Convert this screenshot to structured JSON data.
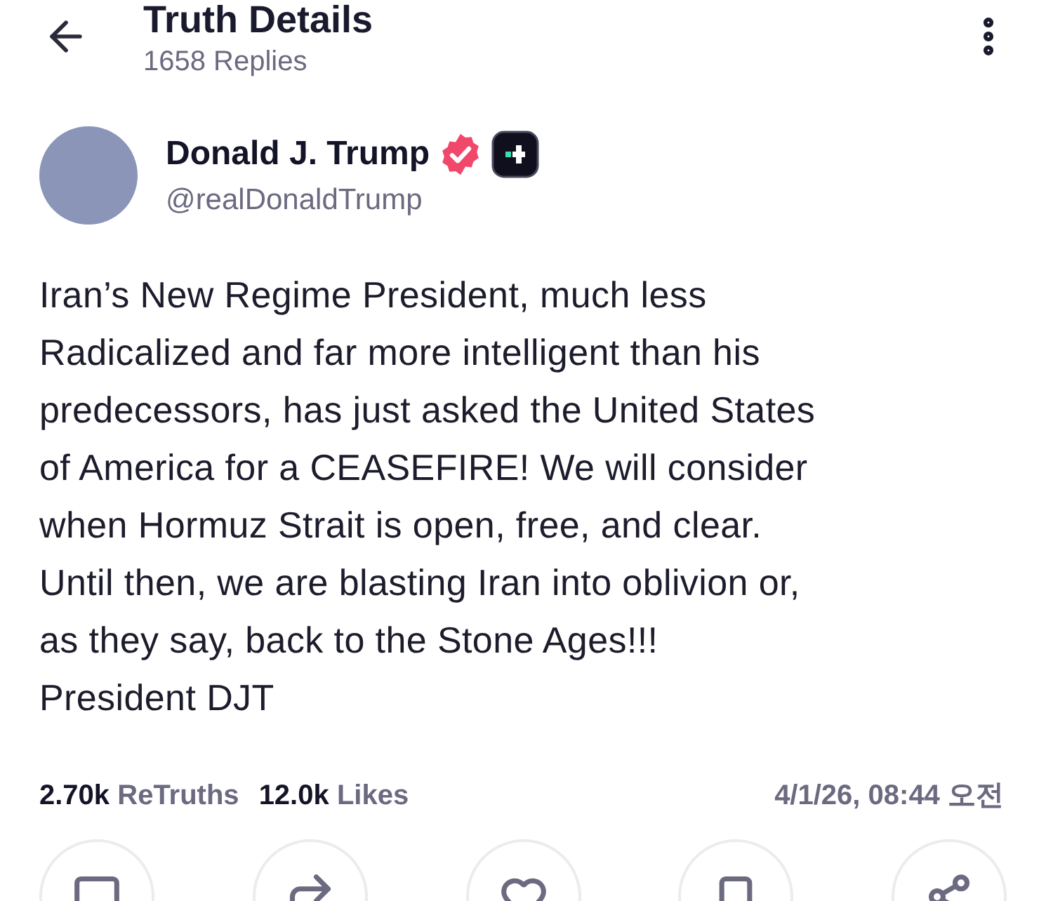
{
  "header": {
    "title": "Truth Details",
    "subtitle": "1658 Replies"
  },
  "author": {
    "name": "Donald J. Trump",
    "handle": "@realDonaldTrump",
    "verified": true
  },
  "post": {
    "text": "Iran’s New Regime President, much less\nRadicalized and far more intelligent than his\npredecessors, has just asked the United States\nof America for a CEASEFIRE! We will consider\nwhen Hormuz Strait is open, free, and clear.\nUntil then, we are blasting Iran into oblivion or,\nas they say, back to the Stone Ages!!!\nPresident DJT"
  },
  "stats": [
    {
      "count": "2.70k",
      "label": "ReTruths"
    },
    {
      "count": "12.0k",
      "label": "Likes"
    }
  ],
  "timestamp": "4/1/26, 08:44 오전",
  "actions": [
    {
      "kind": "reply"
    },
    {
      "kind": "retruth"
    },
    {
      "kind": "like"
    },
    {
      "kind": "bookmark"
    },
    {
      "kind": "share"
    }
  ]
}
